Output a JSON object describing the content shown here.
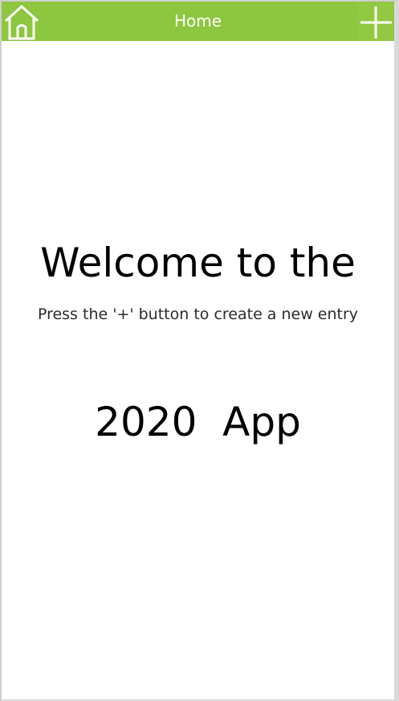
{
  "header": {
    "title": "Home",
    "home_icon": "home-icon",
    "add_icon": "plus-icon",
    "accent_color": "#8dc63f"
  },
  "main": {
    "welcome_line1": "Welcome to the",
    "welcome_line2": "2020  App",
    "hint": "Press the '+' button to create a new entry"
  }
}
